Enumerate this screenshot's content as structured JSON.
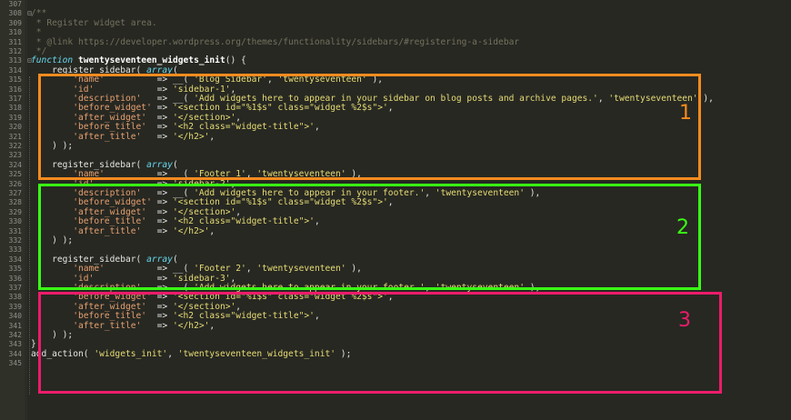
{
  "editor": {
    "lines": [
      {
        "num": "307",
        "marker": "",
        "tokens": []
      },
      {
        "num": "308",
        "marker": "⊟",
        "tokens": [
          {
            "t": "/**",
            "c": "c"
          }
        ]
      },
      {
        "num": "309",
        "marker": "",
        "tokens": [
          {
            "t": " * Register widget area.",
            "c": "c"
          }
        ]
      },
      {
        "num": "310",
        "marker": "",
        "tokens": [
          {
            "t": " *",
            "c": "c"
          }
        ]
      },
      {
        "num": "311",
        "marker": "",
        "tokens": [
          {
            "t": " * @link https://developer.wordpress.org/themes/functionality/sidebars/#registering-a-sidebar",
            "c": "c"
          }
        ]
      },
      {
        "num": "312",
        "marker": "",
        "tokens": [
          {
            "t": " */",
            "c": "c"
          }
        ]
      },
      {
        "num": "313",
        "marker": "⊟",
        "tokens": [
          {
            "t": "function",
            "c": "kw"
          },
          {
            "t": " ",
            "c": "p"
          },
          {
            "t": "twentyseventeen_widgets_init",
            "c": "fn"
          },
          {
            "t": "() {",
            "c": "p"
          }
        ]
      },
      {
        "num": "314",
        "marker": "",
        "tokens": [
          {
            "t": "    register_sidebar( ",
            "c": "p"
          },
          {
            "t": "array",
            "c": "kw"
          },
          {
            "t": "(",
            "c": "p"
          }
        ]
      },
      {
        "num": "315",
        "marker": "",
        "tokens": [
          {
            "t": "        ",
            "c": "p"
          },
          {
            "t": "'name'",
            "c": "k"
          },
          {
            "t": "          => __( ",
            "c": "p"
          },
          {
            "t": "'Blog Sidebar'",
            "c": "s"
          },
          {
            "t": ", ",
            "c": "p"
          },
          {
            "t": "'twentyseventeen'",
            "c": "s"
          },
          {
            "t": " ),",
            "c": "p"
          }
        ]
      },
      {
        "num": "316",
        "marker": "",
        "tokens": [
          {
            "t": "        ",
            "c": "p"
          },
          {
            "t": "'id'",
            "c": "k"
          },
          {
            "t": "            => ",
            "c": "p"
          },
          {
            "t": "'sidebar-1'",
            "c": "s"
          },
          {
            "t": ",",
            "c": "p"
          }
        ]
      },
      {
        "num": "317",
        "marker": "",
        "tokens": [
          {
            "t": "        ",
            "c": "p"
          },
          {
            "t": "'description'",
            "c": "k"
          },
          {
            "t": "   => __( ",
            "c": "p"
          },
          {
            "t": "'Add widgets here to appear in your sidebar on blog posts and archive pages.'",
            "c": "s"
          },
          {
            "t": ", ",
            "c": "p"
          },
          {
            "t": "'twentyseventeen'",
            "c": "s"
          },
          {
            "t": " ),",
            "c": "p"
          }
        ]
      },
      {
        "num": "318",
        "marker": "",
        "tokens": [
          {
            "t": "        ",
            "c": "p"
          },
          {
            "t": "'before_widget'",
            "c": "k"
          },
          {
            "t": " => ",
            "c": "p"
          },
          {
            "t": "'<section id=\"%1$s\" class=\"widget %2$s\">'",
            "c": "s"
          },
          {
            "t": ",",
            "c": "p"
          }
        ]
      },
      {
        "num": "319",
        "marker": "",
        "tokens": [
          {
            "t": "        ",
            "c": "p"
          },
          {
            "t": "'after_widget'",
            "c": "k"
          },
          {
            "t": "  => ",
            "c": "p"
          },
          {
            "t": "'</section>'",
            "c": "s"
          },
          {
            "t": ",",
            "c": "p"
          }
        ]
      },
      {
        "num": "320",
        "marker": "",
        "tokens": [
          {
            "t": "        ",
            "c": "p"
          },
          {
            "t": "'before_title'",
            "c": "k"
          },
          {
            "t": "  => ",
            "c": "p"
          },
          {
            "t": "'<h2 class=\"widget-title\">'",
            "c": "s"
          },
          {
            "t": ",",
            "c": "p"
          }
        ]
      },
      {
        "num": "321",
        "marker": "",
        "tokens": [
          {
            "t": "        ",
            "c": "p"
          },
          {
            "t": "'after_title'",
            "c": "k"
          },
          {
            "t": "   => ",
            "c": "p"
          },
          {
            "t": "'</h2>'",
            "c": "s"
          },
          {
            "t": ",",
            "c": "p"
          }
        ]
      },
      {
        "num": "322",
        "marker": "",
        "tokens": [
          {
            "t": "    ) );",
            "c": "p"
          }
        ]
      },
      {
        "num": "323",
        "marker": "",
        "tokens": []
      },
      {
        "num": "324",
        "marker": "",
        "tokens": [
          {
            "t": "    register_sidebar( ",
            "c": "p"
          },
          {
            "t": "array",
            "c": "kw"
          },
          {
            "t": "(",
            "c": "p"
          }
        ]
      },
      {
        "num": "325",
        "marker": "",
        "tokens": [
          {
            "t": "        ",
            "c": "p"
          },
          {
            "t": "'name'",
            "c": "k"
          },
          {
            "t": "          => __( ",
            "c": "p"
          },
          {
            "t": "'Footer 1'",
            "c": "s"
          },
          {
            "t": ", ",
            "c": "p"
          },
          {
            "t": "'twentyseventeen'",
            "c": "s"
          },
          {
            "t": " ),",
            "c": "p"
          }
        ]
      },
      {
        "num": "326",
        "marker": "",
        "tokens": [
          {
            "t": "        ",
            "c": "p"
          },
          {
            "t": "'id'",
            "c": "k"
          },
          {
            "t": "            => ",
            "c": "p"
          },
          {
            "t": "'sidebar-2'",
            "c": "s"
          },
          {
            "t": ",",
            "c": "p"
          }
        ]
      },
      {
        "num": "327",
        "marker": "",
        "tokens": [
          {
            "t": "        ",
            "c": "p"
          },
          {
            "t": "'description'",
            "c": "k"
          },
          {
            "t": "   => __( ",
            "c": "p"
          },
          {
            "t": "'Add widgets here to appear in your footer.'",
            "c": "s"
          },
          {
            "t": ", ",
            "c": "p"
          },
          {
            "t": "'twentyseventeen'",
            "c": "s"
          },
          {
            "t": " ),",
            "c": "p"
          }
        ]
      },
      {
        "num": "328",
        "marker": "",
        "tokens": [
          {
            "t": "        ",
            "c": "p"
          },
          {
            "t": "'before_widget'",
            "c": "k"
          },
          {
            "t": " => ",
            "c": "p"
          },
          {
            "t": "'<section id=\"%1$s\" class=\"widget %2$s\">'",
            "c": "s"
          },
          {
            "t": ",",
            "c": "p"
          }
        ]
      },
      {
        "num": "329",
        "marker": "",
        "tokens": [
          {
            "t": "        ",
            "c": "p"
          },
          {
            "t": "'after_widget'",
            "c": "k"
          },
          {
            "t": "  => ",
            "c": "p"
          },
          {
            "t": "'</section>'",
            "c": "s"
          },
          {
            "t": ",",
            "c": "p"
          }
        ]
      },
      {
        "num": "330",
        "marker": "",
        "tokens": [
          {
            "t": "        ",
            "c": "p"
          },
          {
            "t": "'before_title'",
            "c": "k"
          },
          {
            "t": "  => ",
            "c": "p"
          },
          {
            "t": "'<h2 class=\"widget-title\">'",
            "c": "s"
          },
          {
            "t": ",",
            "c": "p"
          }
        ]
      },
      {
        "num": "331",
        "marker": "",
        "tokens": [
          {
            "t": "        ",
            "c": "p"
          },
          {
            "t": "'after_title'",
            "c": "k"
          },
          {
            "t": "   => ",
            "c": "p"
          },
          {
            "t": "'</h2>'",
            "c": "s"
          },
          {
            "t": ",",
            "c": "p"
          }
        ]
      },
      {
        "num": "332",
        "marker": "",
        "tokens": [
          {
            "t": "    ) );",
            "c": "p"
          }
        ]
      },
      {
        "num": "333",
        "marker": "",
        "tokens": []
      },
      {
        "num": "334",
        "marker": "",
        "tokens": [
          {
            "t": "    register_sidebar( ",
            "c": "p"
          },
          {
            "t": "array",
            "c": "kw"
          },
          {
            "t": "(",
            "c": "p"
          }
        ]
      },
      {
        "num": "335",
        "marker": "",
        "tokens": [
          {
            "t": "        ",
            "c": "p"
          },
          {
            "t": "'name'",
            "c": "k"
          },
          {
            "t": "          => __( ",
            "c": "p"
          },
          {
            "t": "'Footer 2'",
            "c": "s"
          },
          {
            "t": ", ",
            "c": "p"
          },
          {
            "t": "'twentyseventeen'",
            "c": "s"
          },
          {
            "t": " ),",
            "c": "p"
          }
        ]
      },
      {
        "num": "336",
        "marker": "",
        "tokens": [
          {
            "t": "        ",
            "c": "p"
          },
          {
            "t": "'id'",
            "c": "k"
          },
          {
            "t": "            => ",
            "c": "p"
          },
          {
            "t": "'sidebar-3'",
            "c": "s"
          },
          {
            "t": ",",
            "c": "p"
          }
        ]
      },
      {
        "num": "337",
        "marker": "",
        "tokens": [
          {
            "t": "        ",
            "c": "p"
          },
          {
            "t": "'description'",
            "c": "k"
          },
          {
            "t": "   => __( ",
            "c": "p"
          },
          {
            "t": "'Add widgets here to appear in your footer.'",
            "c": "s"
          },
          {
            "t": ", ",
            "c": "p"
          },
          {
            "t": "'twentyseventeen'",
            "c": "s"
          },
          {
            "t": " ),",
            "c": "p"
          }
        ]
      },
      {
        "num": "338",
        "marker": "",
        "tokens": [
          {
            "t": "        ",
            "c": "p"
          },
          {
            "t": "'before_widget'",
            "c": "k"
          },
          {
            "t": " => ",
            "c": "p"
          },
          {
            "t": "'<section id=\"%1$s\" class=\"widget %2$s\">'",
            "c": "s"
          },
          {
            "t": ",",
            "c": "p"
          }
        ]
      },
      {
        "num": "339",
        "marker": "",
        "tokens": [
          {
            "t": "        ",
            "c": "p"
          },
          {
            "t": "'after_widget'",
            "c": "k"
          },
          {
            "t": "  => ",
            "c": "p"
          },
          {
            "t": "'</section>'",
            "c": "s"
          },
          {
            "t": ",",
            "c": "p"
          }
        ]
      },
      {
        "num": "340",
        "marker": "",
        "tokens": [
          {
            "t": "        ",
            "c": "p"
          },
          {
            "t": "'before_title'",
            "c": "k"
          },
          {
            "t": "  => ",
            "c": "p"
          },
          {
            "t": "'<h2 class=\"widget-title\">'",
            "c": "s"
          },
          {
            "t": ",",
            "c": "p"
          }
        ]
      },
      {
        "num": "341",
        "marker": "",
        "tokens": [
          {
            "t": "        ",
            "c": "p"
          },
          {
            "t": "'after_title'",
            "c": "k"
          },
          {
            "t": "   => ",
            "c": "p"
          },
          {
            "t": "'</h2>'",
            "c": "s"
          },
          {
            "t": ",",
            "c": "p"
          }
        ]
      },
      {
        "num": "342",
        "marker": "",
        "tokens": [
          {
            "t": "    ) );",
            "c": "p"
          }
        ]
      },
      {
        "num": "343",
        "marker": "",
        "tokens": [
          {
            "t": "}",
            "c": "p"
          }
        ]
      },
      {
        "num": "344",
        "marker": "",
        "tokens": [
          {
            "t": "add_action( ",
            "c": "p"
          },
          {
            "t": "'widgets_init'",
            "c": "s"
          },
          {
            "t": ", ",
            "c": "p"
          },
          {
            "t": "'twentyseventeen_widgets_init'",
            "c": "s"
          },
          {
            "t": " );",
            "c": "p"
          }
        ]
      },
      {
        "num": "345",
        "marker": "",
        "tokens": []
      }
    ]
  },
  "annotations": [
    {
      "label": "1",
      "color": "#f68b1f"
    },
    {
      "label": "2",
      "color": "#39ff14"
    },
    {
      "label": "3",
      "color": "#ec1c6b"
    }
  ]
}
